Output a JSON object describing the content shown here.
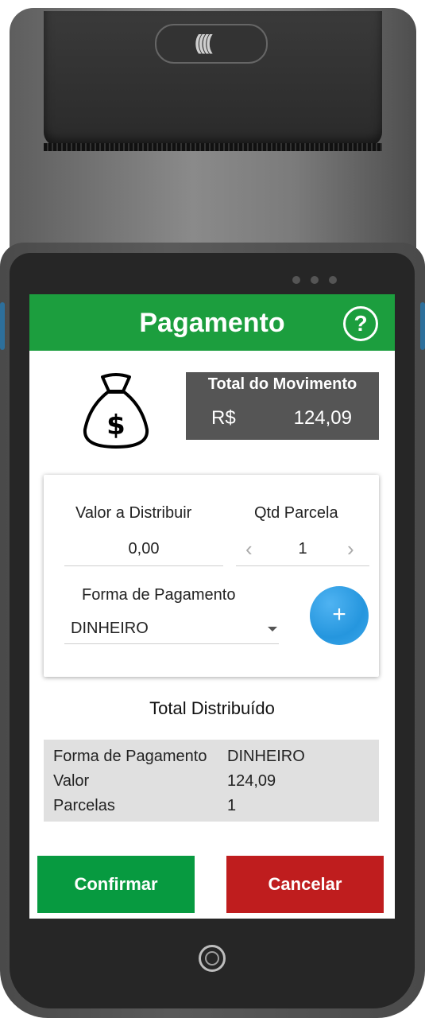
{
  "header": {
    "title": "Pagamento",
    "help_glyph": "?"
  },
  "icons": {
    "money_bag": "money-bag-icon",
    "help": "help-icon",
    "nfc": "contactless-icon"
  },
  "total": {
    "label": "Total do Movimento",
    "currency": "R$",
    "value": "124,09"
  },
  "form": {
    "valor_label": "Valor a Distribuir",
    "valor_value": "0,00",
    "parcela_label": "Qtd Parcela",
    "parcela_value": "1",
    "prev_glyph": "‹",
    "next_glyph": "›",
    "forma_label": "Forma de Pagamento",
    "forma_value": "DINHEIRO",
    "add_glyph": "+"
  },
  "summary": {
    "title": "Total Distribuído",
    "rows": [
      {
        "key": "Forma de Pagamento",
        "value": "DINHEIRO"
      },
      {
        "key": "Valor",
        "value": "124,09"
      },
      {
        "key": "Parcelas",
        "value": "1"
      }
    ]
  },
  "buttons": {
    "confirm": "Confirmar",
    "cancel": "Cancelar"
  },
  "colors": {
    "header": "#1c9e3e",
    "confirm": "#079a40",
    "cancel": "#bf1d1e",
    "fab": "#2596de",
    "total_box": "#555555"
  }
}
